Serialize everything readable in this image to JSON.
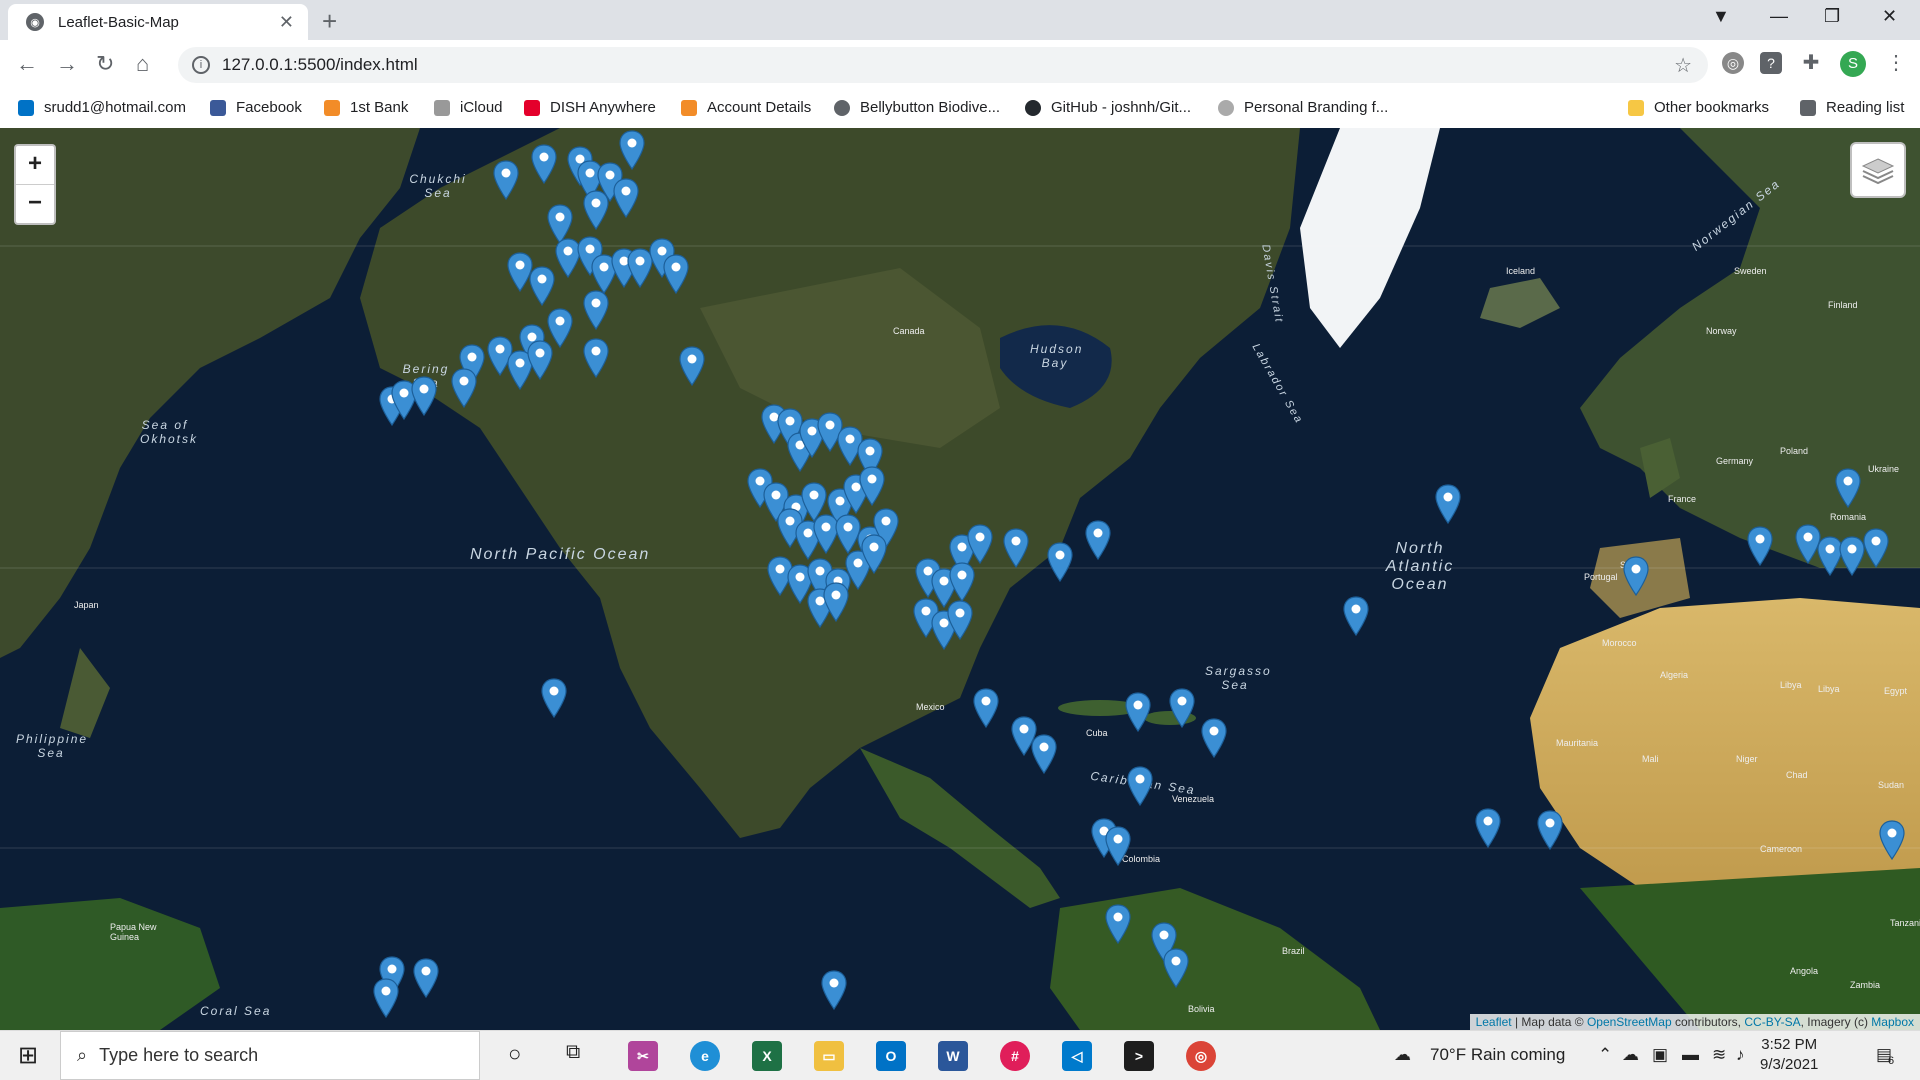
{
  "tab": {
    "title": "Leaflet-Basic-Map",
    "close": "✕",
    "new": "+"
  },
  "window": {
    "min": "—",
    "max": "❐",
    "close": "✕",
    "profile_menu": "⌄"
  },
  "toolbar": {
    "url": "127.0.0.1:5500/index.html",
    "avatar": "S"
  },
  "bookmarks": [
    {
      "label": "srudd1@hotmail.com",
      "color": "#0072c6"
    },
    {
      "label": "Facebook",
      "color": "#3b5998"
    },
    {
      "label": "1st Bank",
      "color": "#f28c28"
    },
    {
      "label": "iCloud",
      "color": "#999999"
    },
    {
      "label": "DISH Anywhere",
      "color": "#e4002b"
    },
    {
      "label": "Account Details",
      "color": "#f28c28"
    },
    {
      "label": "Bellybutton Biodive...",
      "color": "#5f6368"
    },
    {
      "label": "GitHub - joshnh/Git...",
      "color": "#24292e"
    },
    {
      "label": "Personal Branding f...",
      "color": "#aaaaaa"
    },
    {
      "label": "Other bookmarks",
      "color": "#f6c744"
    },
    {
      "label": "Reading list",
      "color": "#5f6368"
    }
  ],
  "map": {
    "zoom_in": "+",
    "zoom_out": "−",
    "ocean_labels": [
      {
        "text": "North Pacific Ocean"
      },
      {
        "text": "North Atlantic Ocean"
      },
      {
        "text": "Bering Sea"
      },
      {
        "text": "Chukchi Sea"
      },
      {
        "text": "Sea of Okhotsk"
      },
      {
        "text": "Philippine Sea"
      },
      {
        "text": "Hudson Bay"
      },
      {
        "text": "Caribbean Sea"
      },
      {
        "text": "Sargasso Sea"
      },
      {
        "text": "Norwegian Sea"
      },
      {
        "text": "Davis Strait"
      },
      {
        "text": "Labrador Sea"
      },
      {
        "text": "Coral Sea"
      }
    ],
    "land_labels": [
      "Canada",
      "Mexico",
      "Venezuela",
      "Colombia",
      "Brazil",
      "Bolivia",
      "Algeria",
      "Libya",
      "Egypt",
      "Mali",
      "Niger",
      "Chad",
      "Sudan",
      "Spain",
      "France",
      "Germany",
      "Poland",
      "Ukraine",
      "Romania",
      "Sweden",
      "Finland",
      "Norway",
      "Iceland",
      "Japan",
      "Angola",
      "Zambia",
      "Cameroon",
      "Papua New Guinea",
      "Cuba",
      "Portugal",
      "Morocco",
      "Mauritania",
      "Libya",
      "Tanzania"
    ],
    "attribution": {
      "leaflet": "Leaflet",
      "sep": " | Map data © ",
      "osm": "OpenStreetMap",
      "contrib": " contributors, ",
      "cc": "CC-BY-SA",
      "imagery": ", Imagery (c) ",
      "mapbox": "Mapbox"
    },
    "marker_color": "#3b8fd4"
  },
  "taskbar": {
    "search_placeholder": "Type here to search",
    "weather": "70°F  Rain coming",
    "time": "3:52 PM",
    "date": "9/3/2021",
    "notifications": "6"
  }
}
